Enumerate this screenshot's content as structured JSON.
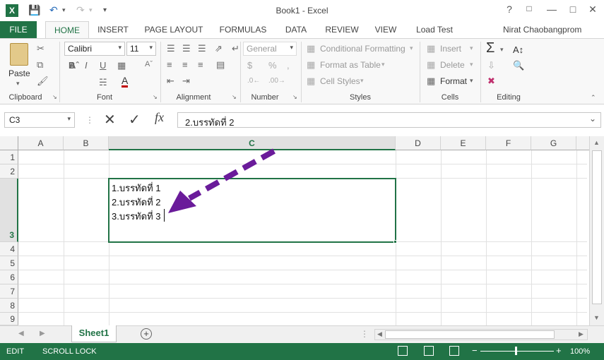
{
  "window": {
    "title": "Book1 - Excel",
    "help": "?",
    "minimize": "—",
    "close": "✕"
  },
  "ribbon_tabs": [
    "FILE",
    "HOME",
    "INSERT",
    "PAGE LAYOUT",
    "FORMULAS",
    "DATA",
    "REVIEW",
    "VIEW",
    "Load Test"
  ],
  "user": "Nirat Chaobangprom",
  "clipboard": {
    "paste": "Paste",
    "label": "Clipboard"
  },
  "font": {
    "name": "Calibri",
    "size": "11",
    "label": "Font"
  },
  "alignment": {
    "label": "Alignment"
  },
  "number": {
    "format": "General",
    "label": "Number"
  },
  "styles": {
    "conditional": "Conditional Formatting",
    "format_table": "Format as Table",
    "cell_styles": "Cell Styles",
    "label": "Styles"
  },
  "cells": {
    "insert": "Insert",
    "delete": "Delete",
    "format": "Format",
    "label": "Cells"
  },
  "editing": {
    "label": "Editing"
  },
  "formula_bar": {
    "name_box": "C3",
    "fx": "fx",
    "content": "2.บรรทัดที่ 2"
  },
  "columns": [
    "A",
    "B",
    "C",
    "D",
    "E",
    "F",
    "G"
  ],
  "rows": [
    "1",
    "2",
    "3",
    "4",
    "5",
    "6",
    "7",
    "8",
    "9"
  ],
  "cell_c3": [
    "1.บรรทัดที่ 1",
    "2.บรรทัดที่ 2",
    "3.บรรทัดที่ 3"
  ],
  "sheet_tabs": [
    "Sheet1"
  ],
  "status": {
    "mode": "EDIT",
    "scroll_lock": "SCROLL LOCK",
    "zoom": "100%"
  },
  "colors": {
    "accent": "#217346",
    "annotation_arrow": "#6a1b9a"
  }
}
